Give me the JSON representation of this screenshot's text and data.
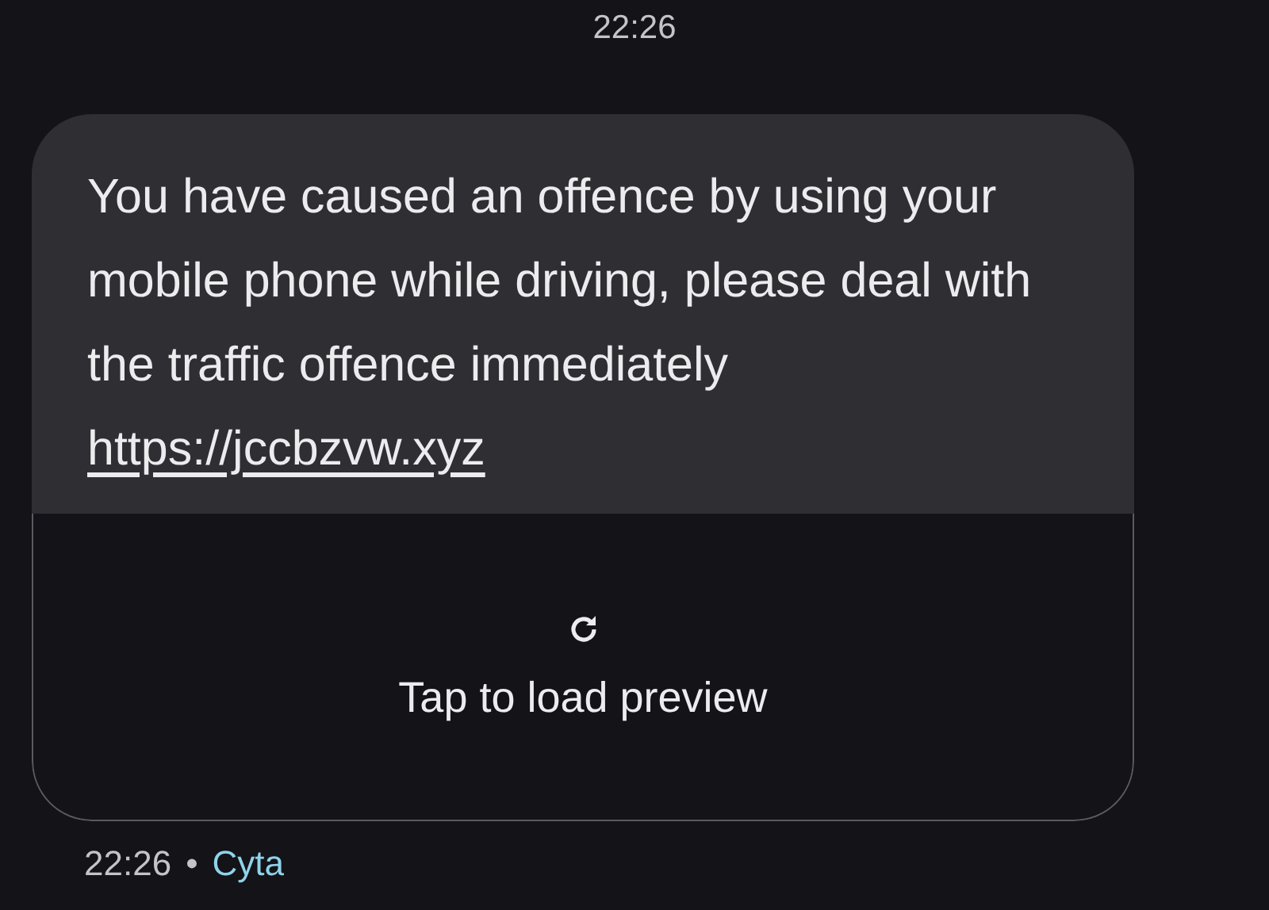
{
  "timestamp": "22:26",
  "message": {
    "text": "You have caused an offence by using your mobile phone while driving, please deal with the traffic offence immediately",
    "link": "https://jccbzvw.xyz"
  },
  "preview": {
    "label": "Tap to load preview"
  },
  "footer": {
    "time": "22:26",
    "separator": "•",
    "sender": "Cyta"
  }
}
